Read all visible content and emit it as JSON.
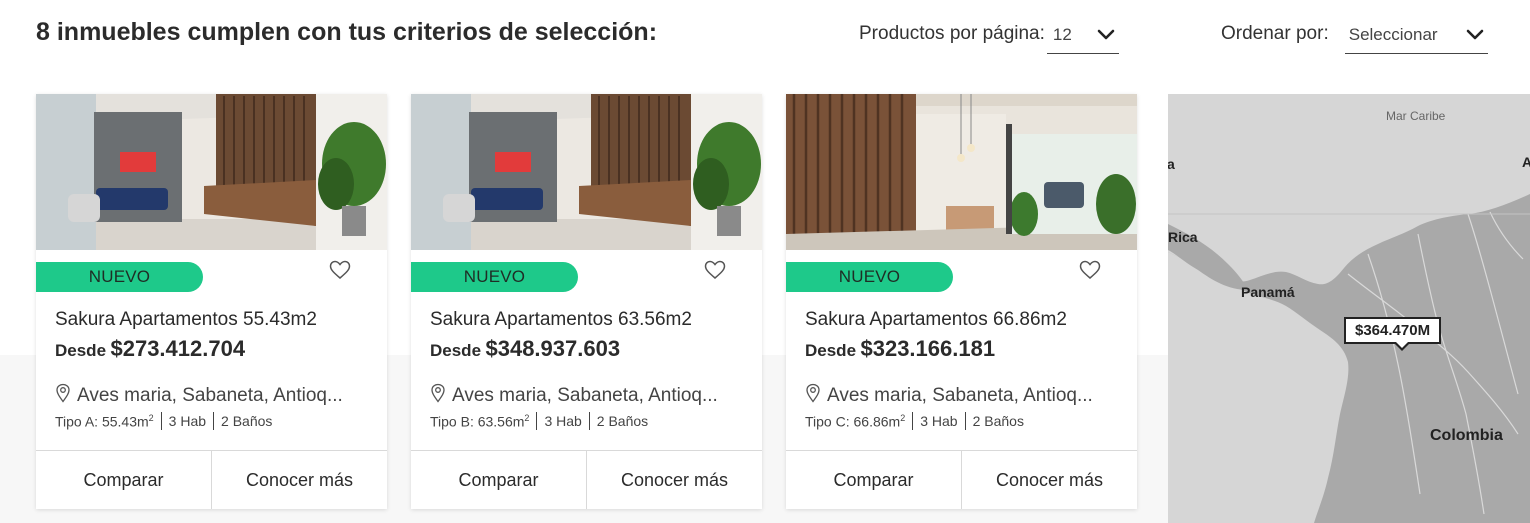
{
  "results_title": "8 inmuebles cumplen con tus criterios de selección:",
  "per_page": {
    "label": "Productos por página:",
    "value": "12"
  },
  "order_by": {
    "label": "Ordenar por:",
    "value": "Seleccionar"
  },
  "cards": [
    {
      "badge": "NUEVO",
      "name": "Sakura Apartamentos 55.43m2",
      "price_prefix": "Desde",
      "price": "$273.412.704",
      "location": "Aves maria, Sabaneta, Antioq...",
      "spec_type": "Tipo A: 55.43m",
      "spec_sup": "2",
      "rooms": "3 Hab",
      "baths": "2 Baños",
      "compare": "Comparar",
      "details": "Conocer más"
    },
    {
      "badge": "NUEVO",
      "name": "Sakura Apartamentos 63.56m2",
      "price_prefix": "Desde",
      "price": "$348.937.603",
      "location": "Aves maria, Sabaneta, Antioq...",
      "spec_type": "Tipo B: 63.56m",
      "spec_sup": "2",
      "rooms": "3 Hab",
      "baths": "2 Baños",
      "compare": "Comparar",
      "details": "Conocer más"
    },
    {
      "badge": "NUEVO",
      "name": "Sakura Apartamentos 66.86m2",
      "price_prefix": "Desde",
      "price": "$323.166.181",
      "location": "Aves maria, Sabaneta, Antioq...",
      "spec_type": "Tipo C: 66.86m",
      "spec_sup": "2",
      "rooms": "3 Hab",
      "baths": "2 Baños",
      "compare": "Comparar",
      "details": "Conocer más"
    }
  ],
  "map": {
    "sea_label": "Mar Caribe",
    "label_rica": "Rica",
    "label_a": "a",
    "label_a2": "A",
    "label_panama": "Panamá",
    "label_colombia": "Colombia",
    "price_pin": "$364.470M"
  },
  "colors": {
    "badge": "#1ec98a",
    "map_land": "#a9a9a9",
    "map_sea": "#d6d6d6"
  }
}
